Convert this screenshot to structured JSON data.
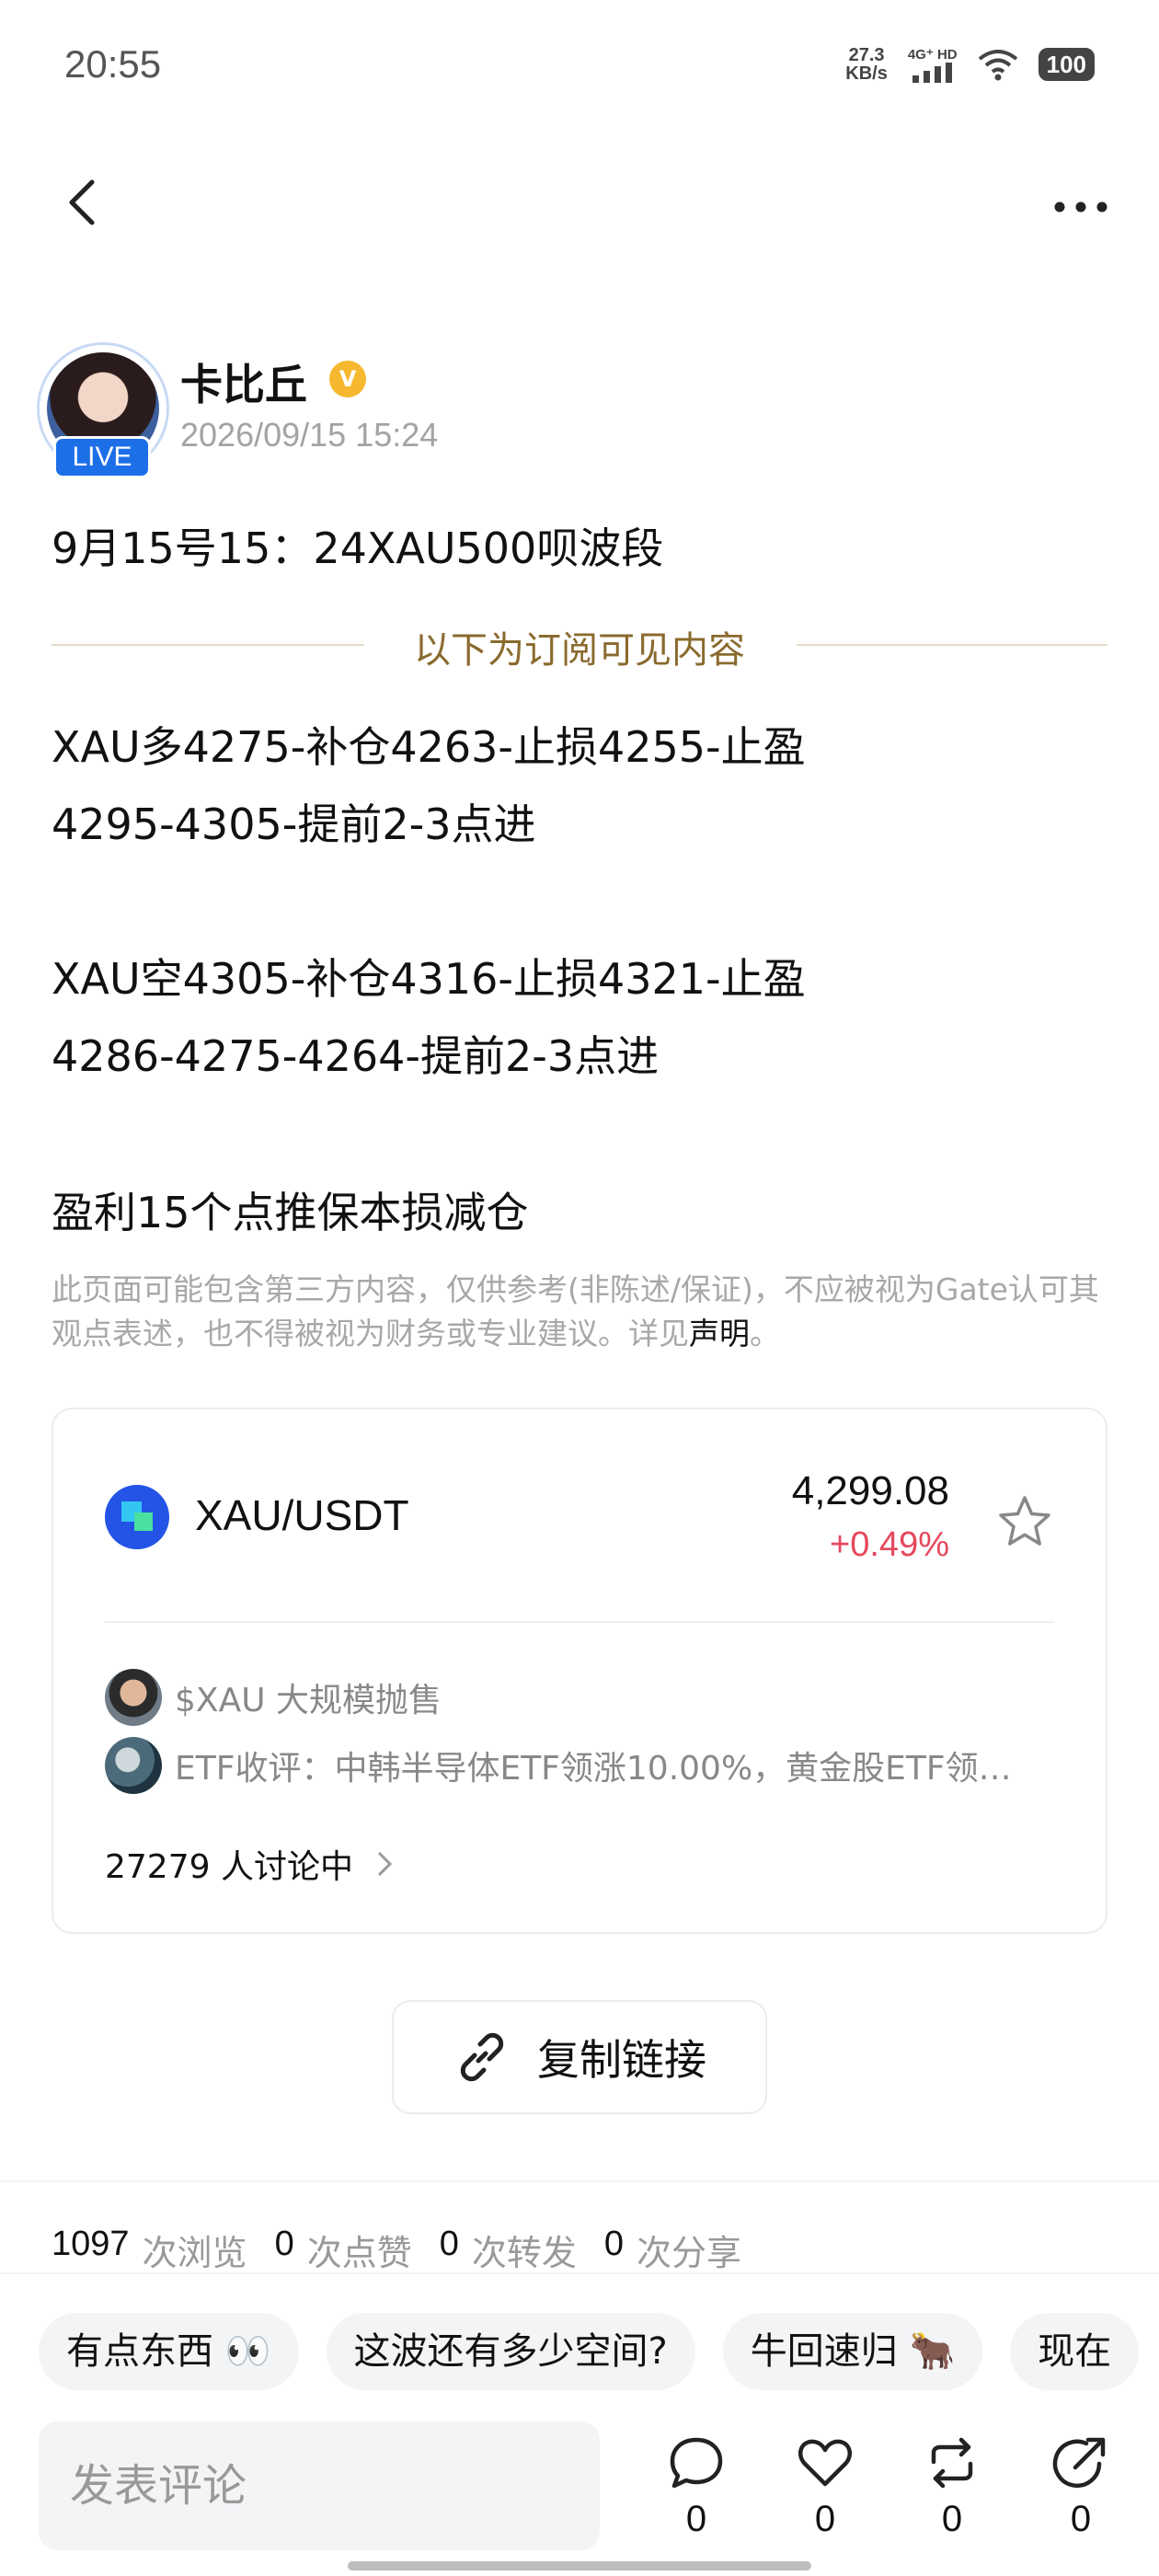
{
  "status_bar": {
    "time": "20:55",
    "net_speed_value": "27.3",
    "net_speed_unit": "KB/s",
    "signal": "4G⁺ HD",
    "battery": "100"
  },
  "author": {
    "name": "卡比丘",
    "badge": "LIVE",
    "verified_mark": "V",
    "time": "2026/09/15 15:24"
  },
  "post": {
    "title": "9月15号15：24XAU500呗波段",
    "subscription_label": "以下为订阅可见内容",
    "paragraphs": [
      "XAU多4275-补仓4263-止损4255-止盈",
      "4295-4305-提前2-3点进",
      "XAU空4305-补仓4316-止损4321-止盈",
      "4286-4275-4264-提前2-3点进",
      "盈利15个点推保本损减仓"
    ],
    "disclaimer": "此页面可能包含第三方内容，仅供参考(非陈述/保证)，不应被视为Gate认可其观点表述，也不得被视为财务或专业建议。详见",
    "disclaimer_link": "声明",
    "disclaimer_end": "。"
  },
  "market_card": {
    "pair": "XAU/USDT",
    "price": "4,299.08",
    "change": "+0.49%",
    "news": [
      {
        "text": "$XAU 大规模抛售"
      },
      {
        "text": "ETF收评：中韩半导体ETF领涨10.00%，黄金股ETF领…"
      }
    ],
    "discussion": "27279 人讨论中"
  },
  "copy_link_label": "复制链接",
  "stats": {
    "views": "1097",
    "views_label": "次浏览",
    "likes": "0",
    "likes_label": "次点赞",
    "reposts": "0",
    "reposts_label": "次转发",
    "shares": "0",
    "shares_label": "次分享"
  },
  "quick_replies": [
    "有点东西 👀",
    "这波还有多少空间?",
    "牛回速归 🐂",
    "现在"
  ],
  "bottom_bar": {
    "comment_placeholder": "发表评论",
    "comment_count": "0",
    "like_count": "0",
    "repost_count": "0",
    "share_count": "0"
  },
  "colors": {
    "price_up": "#e5485d",
    "subscription_gold": "#8a6a2e",
    "live_blue": "#1d6fe8",
    "verified_gold": "#f5b82e"
  }
}
